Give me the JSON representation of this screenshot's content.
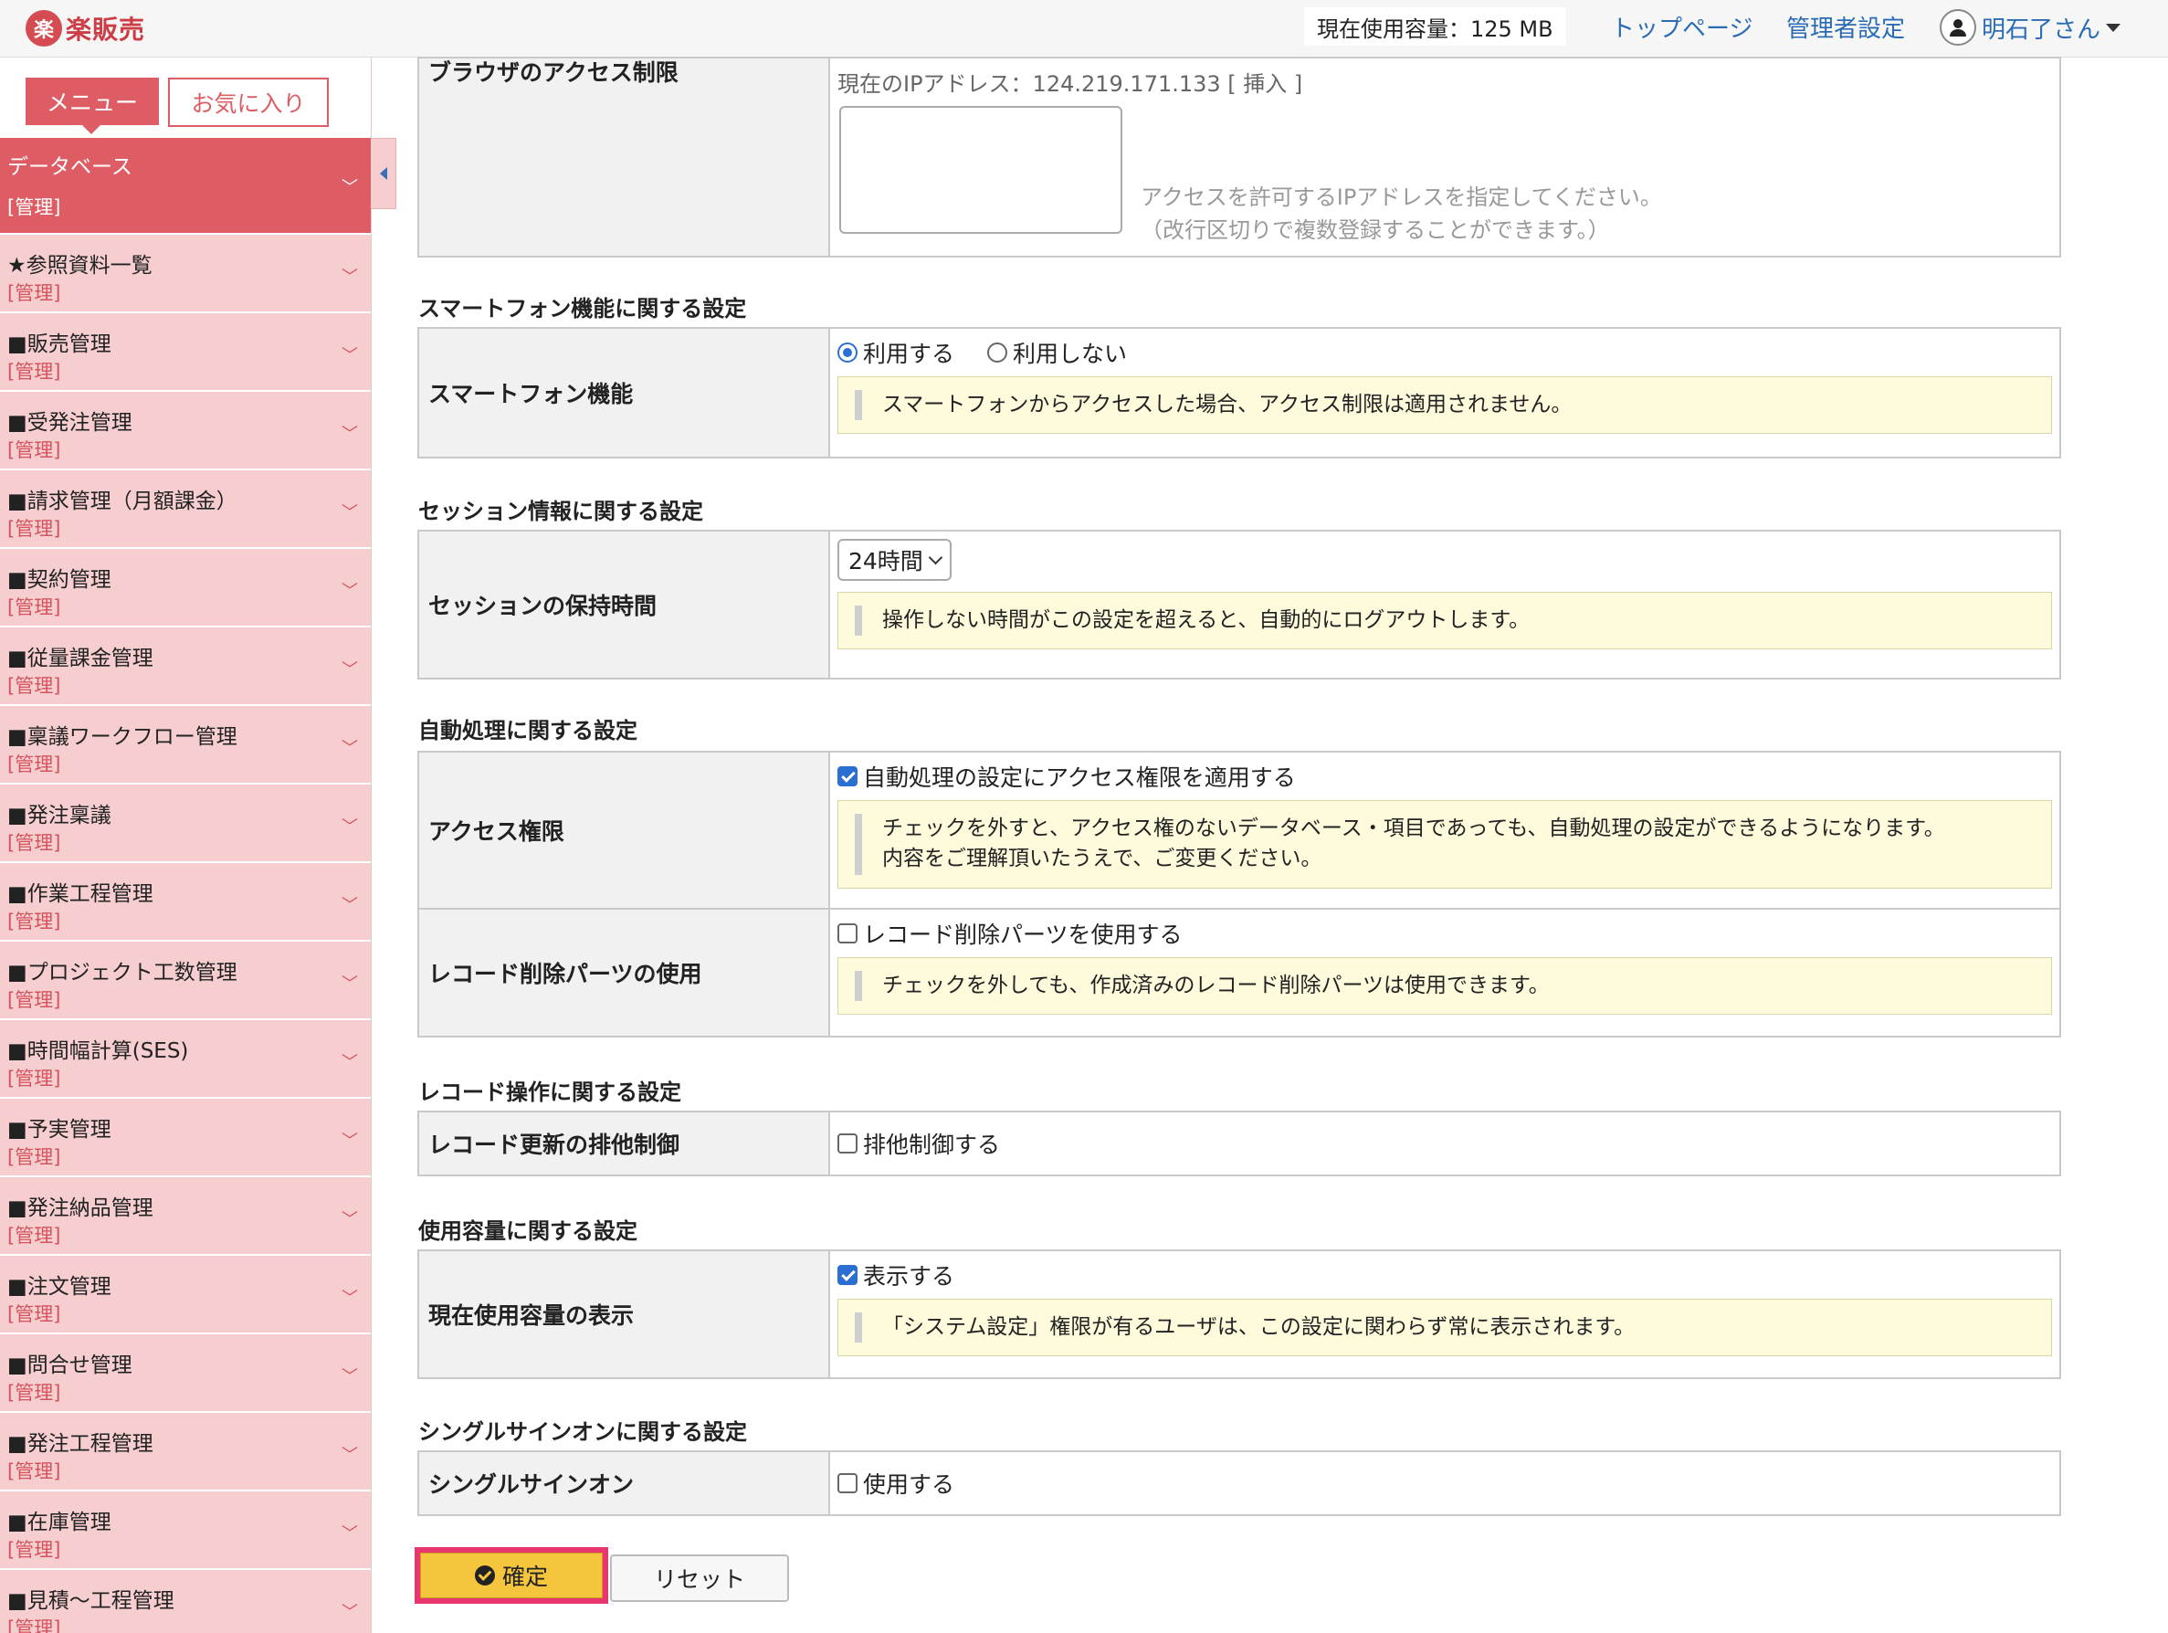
{
  "header": {
    "logo_mark": "楽",
    "logo_text": "楽販売",
    "usage": "現在使用容量：125 MB",
    "links": [
      "トップページ",
      "管理者設定"
    ],
    "user": "明石了さん"
  },
  "sidebar": {
    "tab_menu": "メニュー",
    "tab_favorites": "お気に入り",
    "items": [
      {
        "label": "データベース",
        "sub": "[管理]"
      },
      {
        "label": "★参照資料一覧",
        "sub": "[管理]"
      },
      {
        "label": "■販売管理",
        "sub": "[管理]"
      },
      {
        "label": "■受発注管理",
        "sub": "[管理]"
      },
      {
        "label": "■請求管理（月額課金）",
        "sub": "[管理]"
      },
      {
        "label": "■契約管理",
        "sub": "[管理]"
      },
      {
        "label": "■従量課金管理",
        "sub": "[管理]"
      },
      {
        "label": "■稟議ワークフロー管理",
        "sub": "[管理]"
      },
      {
        "label": "■発注稟議",
        "sub": "[管理]"
      },
      {
        "label": "■作業工程管理",
        "sub": "[管理]"
      },
      {
        "label": "■プロジェクト工数管理",
        "sub": "[管理]"
      },
      {
        "label": "■時間幅計算(SES)",
        "sub": "[管理]"
      },
      {
        "label": "■予実管理",
        "sub": "[管理]"
      },
      {
        "label": "■発注納品管理",
        "sub": "[管理]"
      },
      {
        "label": "■注文管理",
        "sub": "[管理]"
      },
      {
        "label": "■問合せ管理",
        "sub": "[管理]"
      },
      {
        "label": "■発注工程管理",
        "sub": "[管理]"
      },
      {
        "label": "■在庫管理",
        "sub": "[管理]"
      },
      {
        "label": "■見積〜工程管理",
        "sub": "[管理]"
      }
    ]
  },
  "browser": {
    "label": "ブラウザのアクセス制限",
    "ip_line": "現在のIPアドレス：124.219.171.133 [ 挿入 ]",
    "help1": "アクセスを許可するIPアドレスを指定してください。",
    "help2": "（改行区切りで複数登録することができます。）"
  },
  "smartphone": {
    "section": "スマートフォン機能に関する設定",
    "label": "スマートフォン機能",
    "opt_use": "利用する",
    "opt_nouse": "利用しない",
    "note": "スマートフォンからアクセスした場合、アクセス制限は適用されません。"
  },
  "session": {
    "section": "セッション情報に関する設定",
    "label": "セッションの保持時間",
    "value": "24時間",
    "note": "操作しない時間がこの設定を超えると、自動的にログアウトします。"
  },
  "auto": {
    "section": "自動処理に関する設定",
    "access_label": "アクセス権限",
    "access_check": "自動処理の設定にアクセス権限を適用する",
    "access_note1": "チェックを外すと、アクセス権のないデータベース・項目であっても、自動処理の設定ができるようになります。",
    "access_note2": "内容をご理解頂いたうえで、ご変更ください。",
    "delete_label": "レコード削除パーツの使用",
    "delete_check": "レコード削除パーツを使用する",
    "delete_note": "チェックを外しても、作成済みのレコード削除パーツは使用できます。"
  },
  "record": {
    "section": "レコード操作に関する設定",
    "label": "レコード更新の排他制御",
    "check": "排他制御する"
  },
  "capacity": {
    "section": "使用容量に関する設定",
    "label": "現在使用容量の表示",
    "check": "表示する",
    "note": "「システム設定」権限が有るユーザは、この設定に関わらず常に表示されます。"
  },
  "sso": {
    "section": "シングルサインオンに関する設定",
    "label": "シングルサインオン",
    "check": "使用する"
  },
  "buttons": {
    "confirm": "確定",
    "reset": "リセット"
  }
}
